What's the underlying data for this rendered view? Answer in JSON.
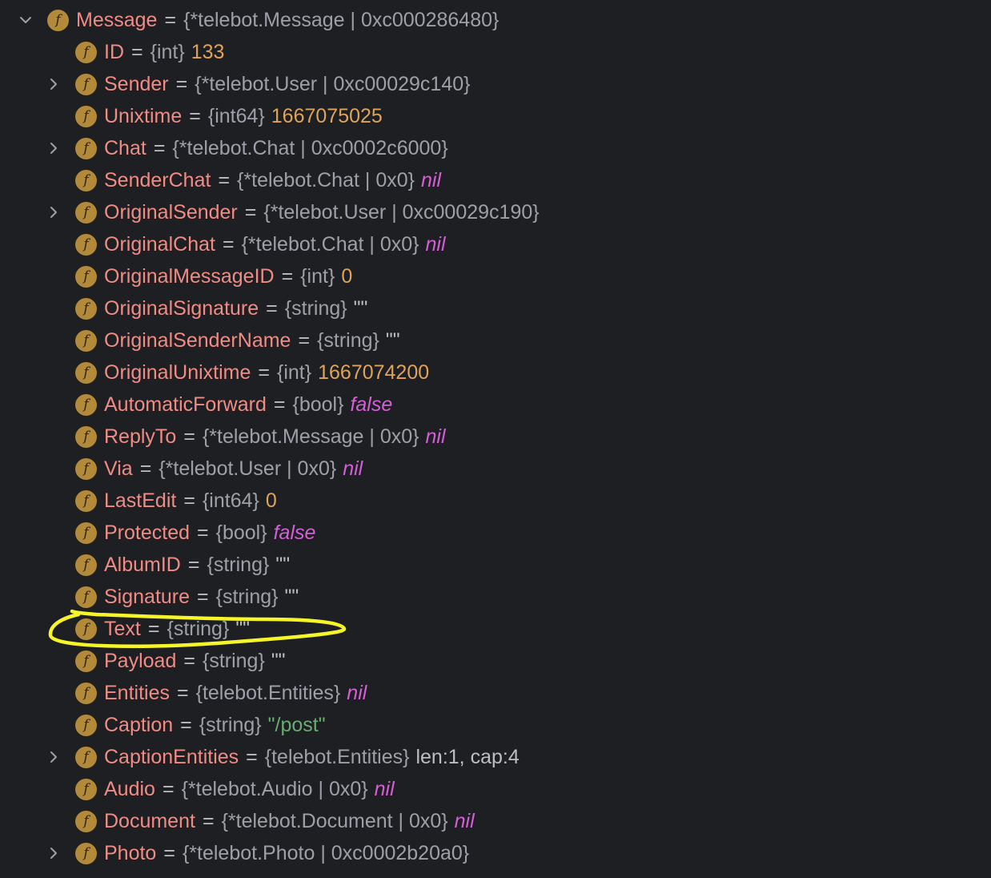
{
  "tree": {
    "root": {
      "name": "Message",
      "type": "{*telebot.Message | 0xc000286480}",
      "expanded": true
    },
    "children": [
      {
        "name": "ID",
        "type": "{int}",
        "value": "133",
        "kind": "num",
        "expandable": false
      },
      {
        "name": "Sender",
        "type": "{*telebot.User | 0xc00029c140}",
        "value": "",
        "kind": "plain",
        "expandable": true
      },
      {
        "name": "Unixtime",
        "type": "{int64}",
        "value": "1667075025",
        "kind": "num",
        "expandable": false
      },
      {
        "name": "Chat",
        "type": "{*telebot.Chat | 0xc0002c6000}",
        "value": "",
        "kind": "plain",
        "expandable": true
      },
      {
        "name": "SenderChat",
        "type": "{*telebot.Chat | 0x0}",
        "value": "nil",
        "kind": "nil",
        "expandable": false
      },
      {
        "name": "OriginalSender",
        "type": "{*telebot.User | 0xc00029c190}",
        "value": "",
        "kind": "plain",
        "expandable": true
      },
      {
        "name": "OriginalChat",
        "type": "{*telebot.Chat | 0x0}",
        "value": "nil",
        "kind": "nil",
        "expandable": false
      },
      {
        "name": "OriginalMessageID",
        "type": "{int}",
        "value": "0",
        "kind": "num",
        "expandable": false
      },
      {
        "name": "OriginalSignature",
        "type": "{string}",
        "value": "\"\"",
        "kind": "empty-str",
        "expandable": false
      },
      {
        "name": "OriginalSenderName",
        "type": "{string}",
        "value": "\"\"",
        "kind": "empty-str",
        "expandable": false
      },
      {
        "name": "OriginalUnixtime",
        "type": "{int}",
        "value": "1667074200",
        "kind": "num",
        "expandable": false
      },
      {
        "name": "AutomaticForward",
        "type": "{bool}",
        "value": "false",
        "kind": "bool",
        "expandable": false
      },
      {
        "name": "ReplyTo",
        "type": "{*telebot.Message | 0x0}",
        "value": "nil",
        "kind": "nil",
        "expandable": false
      },
      {
        "name": "Via",
        "type": "{*telebot.User | 0x0}",
        "value": "nil",
        "kind": "nil",
        "expandable": false
      },
      {
        "name": "LastEdit",
        "type": "{int64}",
        "value": "0",
        "kind": "num",
        "expandable": false
      },
      {
        "name": "Protected",
        "type": "{bool}",
        "value": "false",
        "kind": "bool",
        "expandable": false
      },
      {
        "name": "AlbumID",
        "type": "{string}",
        "value": "\"\"",
        "kind": "empty-str",
        "expandable": false
      },
      {
        "name": "Signature",
        "type": "{string}",
        "value": "\"\"",
        "kind": "empty-str",
        "expandable": false
      },
      {
        "name": "Text",
        "type": "{string}",
        "value": "\"\"",
        "kind": "empty-str",
        "expandable": false
      },
      {
        "name": "Payload",
        "type": "{string}",
        "value": "\"\"",
        "kind": "empty-str",
        "expandable": false
      },
      {
        "name": "Entities",
        "type": "{telebot.Entities}",
        "value": "nil",
        "kind": "nil",
        "expandable": false
      },
      {
        "name": "Caption",
        "type": "{string}",
        "value": "\"/post\"",
        "kind": "str",
        "expandable": false
      },
      {
        "name": "CaptionEntities",
        "type": "{telebot.Entities}",
        "value": "len:1, cap:4",
        "kind": "plain",
        "expandable": true
      },
      {
        "name": "Audio",
        "type": "{*telebot.Audio | 0x0}",
        "value": "nil",
        "kind": "nil",
        "expandable": false
      },
      {
        "name": "Document",
        "type": "{*telebot.Document | 0x0}",
        "value": "nil",
        "kind": "nil",
        "expandable": false
      },
      {
        "name": "Photo",
        "type": "{*telebot.Photo | 0xc0002b20a0}",
        "value": "",
        "kind": "plain",
        "expandable": true
      }
    ]
  },
  "icons": {
    "field": "f",
    "expanded": "chevron-down-icon",
    "collapsed": "chevron-right-icon"
  },
  "colors": {
    "background": "#1e1f22",
    "field_name": "#ef8c86",
    "type": "#9da0a8",
    "number": "#e0a35c",
    "keyword": "#d45fd6",
    "string": "#6aab73",
    "field_icon": "#b38a3a",
    "annotation": "#f5f52a"
  }
}
